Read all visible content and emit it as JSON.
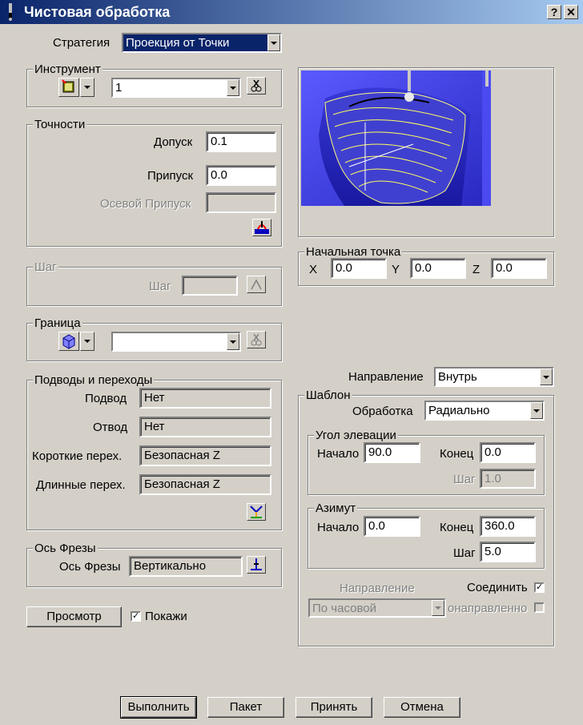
{
  "window": {
    "title": "Чистовая обработка",
    "help": "?",
    "close": "✕"
  },
  "strategy": {
    "label": "Стратегия",
    "value": "Проекция от Точки"
  },
  "tool": {
    "legend": "Инструмент",
    "value": "1"
  },
  "tolerances": {
    "legend": "Точности",
    "tolerance_label": "Допуск",
    "tolerance_value": "0.1",
    "allowance_label": "Припуск",
    "allowance_value": "0.0",
    "axial_label": "Осевой Припуск",
    "axial_value": ""
  },
  "step": {
    "legend": "Шаг",
    "label": "Шаг",
    "value": ""
  },
  "boundary": {
    "legend": "Граница",
    "value": ""
  },
  "leads": {
    "legend": "Подводы и переходы",
    "lead_in_label": "Подвод",
    "lead_in_value": "Нет",
    "lead_out_label": "Отвод",
    "lead_out_value": "Нет",
    "short_label": "Короткие перех.",
    "short_value": "Безопасная Z",
    "long_label": "Длинные перех.",
    "long_value": "Безопасная Z"
  },
  "tool_axis": {
    "legend": "Ось Фрезы",
    "label": "Ось Фрезы",
    "value": "Вертикально"
  },
  "preview_button": "Просмотр",
  "show": {
    "label": "Покажи",
    "checked": true
  },
  "start_point": {
    "legend": "Начальная точка",
    "x_label": "X",
    "x": "0.0",
    "y_label": "Y",
    "y": "0.0",
    "z_label": "Z",
    "z": "0.0"
  },
  "direction": {
    "label": "Направление",
    "value": "Внутрь"
  },
  "pattern": {
    "legend": "Шаблон",
    "machining_label": "Обработка",
    "machining_value": "Радиально",
    "elevation": {
      "legend": "Угол элевации",
      "start_label": "Начало",
      "start": "90.0",
      "end_label": "Конец",
      "end": "0.0",
      "step_label": "Шаг",
      "step": "1.0"
    },
    "azimuth": {
      "legend": "Азимут",
      "start_label": "Начало",
      "start": "0.0",
      "end_label": "Конец",
      "end": "360.0",
      "step_label": "Шаг",
      "step": "5.0"
    },
    "dir_label": "Направление",
    "dir_value": "По часовой",
    "connect_label": "Соединить",
    "connect_checked": true,
    "unidir_label": "онаправленно",
    "unidir_checked": false
  },
  "buttons": {
    "execute": "Выполнить",
    "batch": "Пакет",
    "apply": "Принять",
    "cancel": "Отмена"
  }
}
